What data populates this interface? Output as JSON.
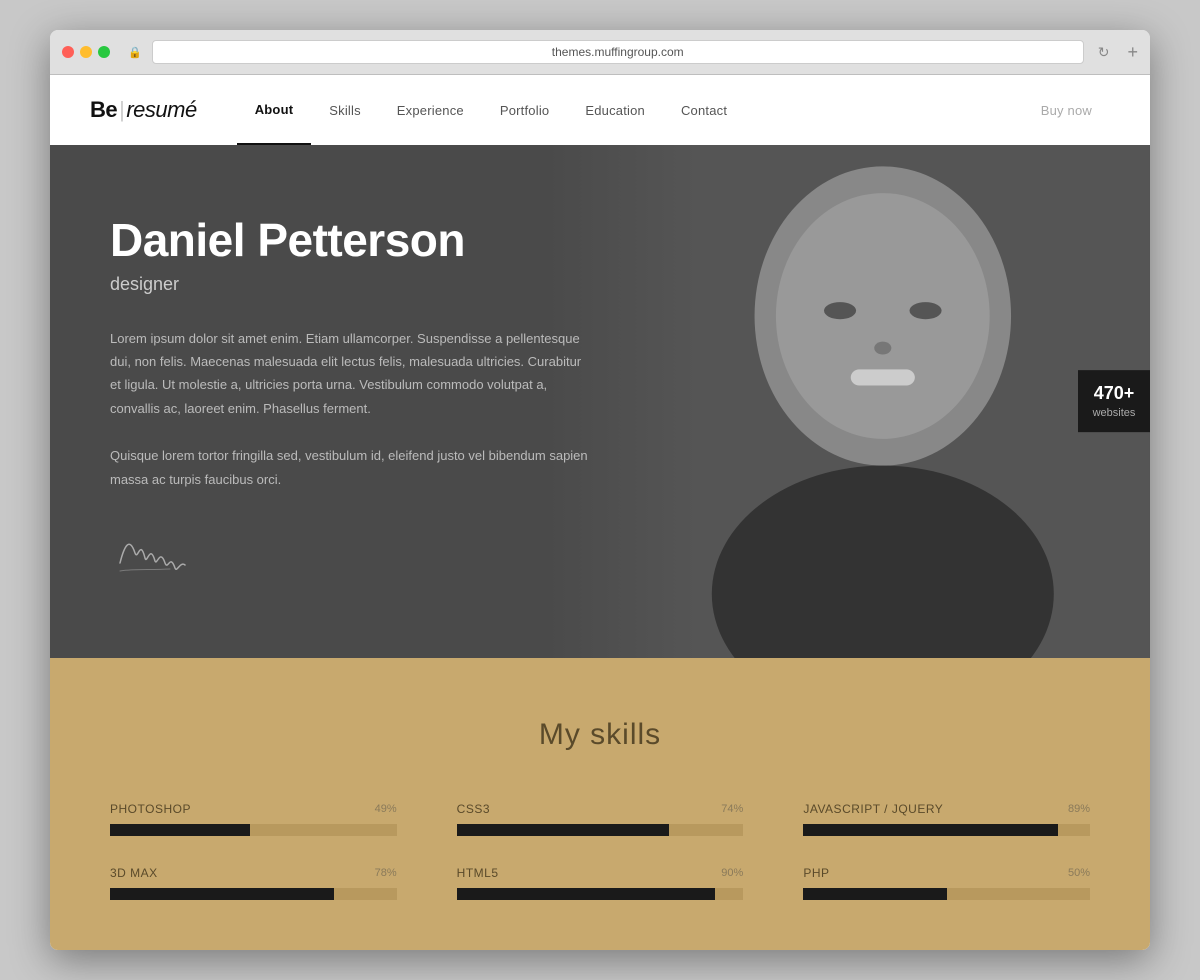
{
  "browser": {
    "url": "themes.muffingroup.com",
    "add_tab_label": "+"
  },
  "site": {
    "logo": {
      "bold": "Be",
      "separator": "|",
      "text": "resumé"
    },
    "nav": [
      {
        "id": "about",
        "label": "About",
        "active": true
      },
      {
        "id": "skills",
        "label": "Skills",
        "active": false
      },
      {
        "id": "experience",
        "label": "Experience",
        "active": false
      },
      {
        "id": "portfolio",
        "label": "Portfolio",
        "active": false
      },
      {
        "id": "education",
        "label": "Education",
        "active": false
      },
      {
        "id": "contact",
        "label": "Contact",
        "active": false
      },
      {
        "id": "buynow",
        "label": "Buy now",
        "active": false,
        "muted": true
      }
    ]
  },
  "hero": {
    "name": "Daniel Petterson",
    "title": "designer",
    "bio1": "Lorem ipsum dolor sit amet enim. Etiam ullamcorper. Suspendisse a pellentesque dui, non felis. Maecenas malesuada elit lectus felis, malesuada ultricies. Curabitur et ligula. Ut molestie a, ultricies porta urna. Vestibulum commodo volutpat a, convallis ac, laoreet enim. Phasellus ferment.",
    "bio2": "Quisque lorem tortor fringilla sed, vestibulum id, eleifend justo vel bibendum sapien massa ac turpis faucibus orci.",
    "badge": {
      "number": "470+",
      "label": "websites"
    }
  },
  "skills": {
    "title": "My skills",
    "items": [
      {
        "name": "Photoshop",
        "percent": 49
      },
      {
        "name": "CSS3",
        "percent": 74
      },
      {
        "name": "Javascript / jQuery",
        "percent": 89
      },
      {
        "name": "3D Max",
        "percent": 78
      },
      {
        "name": "HTML5",
        "percent": 90
      },
      {
        "name": "PHP",
        "percent": 50
      }
    ]
  },
  "colors": {
    "nav_active": "#111111",
    "hero_bg": "#4a4a4a",
    "skills_bg": "#c8a96e",
    "bar_fill": "#1a1a1a",
    "bar_bg": "#b8995e",
    "badge_bg": "#1a1a1a"
  }
}
